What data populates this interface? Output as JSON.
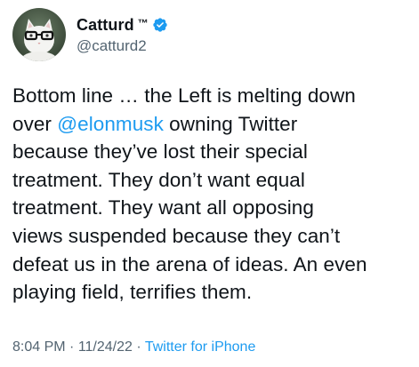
{
  "author": {
    "display_name": "Catturd",
    "trademark": "™",
    "handle": "@catturd2",
    "verified": true,
    "avatar_icon": "cat-with-glasses-avatar"
  },
  "tweet": {
    "lines": [
      [
        "Bottom line … the Left is melting down"
      ],
      [
        "over ",
        "@elonmusk",
        " owning Twitter"
      ],
      [
        "because they’ve lost their special"
      ],
      [
        "treatment. They don’t want equal"
      ],
      [
        "treatment. They want all opposing"
      ],
      [
        "views suspended because they can’t"
      ],
      [
        "defeat us in the arena of ideas. An even"
      ],
      [
        "playing field, terrifies them."
      ]
    ],
    "mention": "@elonmusk"
  },
  "meta": {
    "time": "8:04 PM",
    "separator": " · ",
    "date": "11/24/22",
    "source": "Twitter for iPhone"
  },
  "colors": {
    "text": "#0f1419",
    "secondary": "#536471",
    "link": "#1d9bf0",
    "verified": "#1d9bf0"
  }
}
